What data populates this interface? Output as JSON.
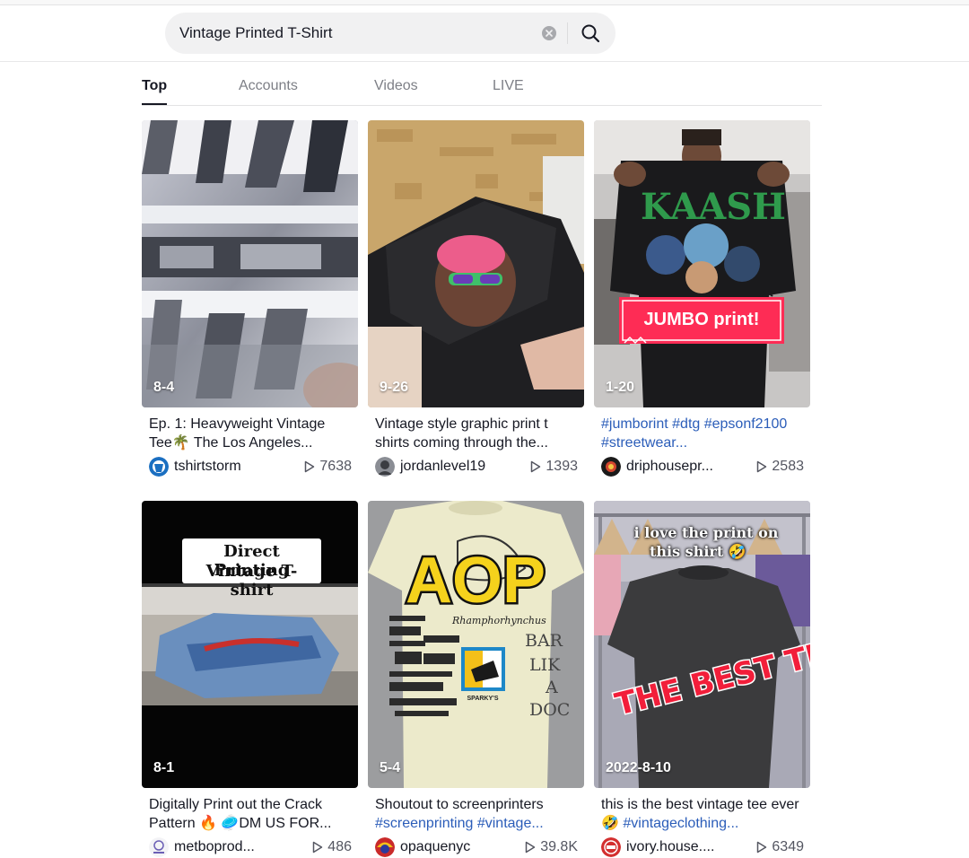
{
  "search": {
    "value": "Vintage Printed T-Shirt"
  },
  "tabs": [
    {
      "label": "Top",
      "active": true
    },
    {
      "label": "Accounts",
      "active": false
    },
    {
      "label": "Videos",
      "active": false
    },
    {
      "label": "LIVE",
      "active": false
    }
  ],
  "videos": [
    {
      "date": "8-4",
      "caption": "Ep. 1: Heavyweight Vintage Tee🌴 The Los Angeles...",
      "user": "tshirtstorm",
      "plays": "7638"
    },
    {
      "date": "9-26",
      "caption": "Vintage style graphic print t shirts coming through the...",
      "user": "jordanlevel19",
      "plays": "1393"
    },
    {
      "date": "1-20",
      "caption": "#jumborint #dtg #epsonf2100 #streetwear...",
      "user": "driphousepr...",
      "plays": "2583",
      "overlay": "JUMBO print!",
      "shirt_text": "KAASH"
    },
    {
      "date": "8-1",
      "caption_start": "Digitally Print out the Crack Pattern",
      "caption_end": "DM US FOR...",
      "user": "metboprod...",
      "plays": "486",
      "overlay_line1": "Direct Printing",
      "overlay_line2": "Vintage T-shirt"
    },
    {
      "date": "5-4",
      "caption_start": "Shoutout to screenprinters",
      "caption_tags": "#screenprinting #vintage...",
      "user": "opaquenyc",
      "plays": "39.8K",
      "overlay": "AOP",
      "shirt_text_1": "BAR",
      "shirt_text_2": "LIK",
      "shirt_text_3": "A",
      "shirt_text_4": "DOC",
      "shirt_script": "Rhamphorhynchus",
      "shirt_logo": "SPARKY'S"
    },
    {
      "date": "2022-8-10",
      "caption_start": "this is the best vintage tee ever",
      "caption_tags": "#vintageclothing...",
      "user": "ivory.house....",
      "plays": "6349",
      "overlay_line1": "i love the print on",
      "overlay_line2": "this shirt",
      "overlay_big": "THE BEST TEE,"
    }
  ],
  "colors": {
    "accent_tag": "#2b5db9",
    "jumbo_red": "#fe2c55"
  },
  "icons": {
    "clear": "clear-icon",
    "search": "search-icon",
    "play": "play-icon"
  }
}
